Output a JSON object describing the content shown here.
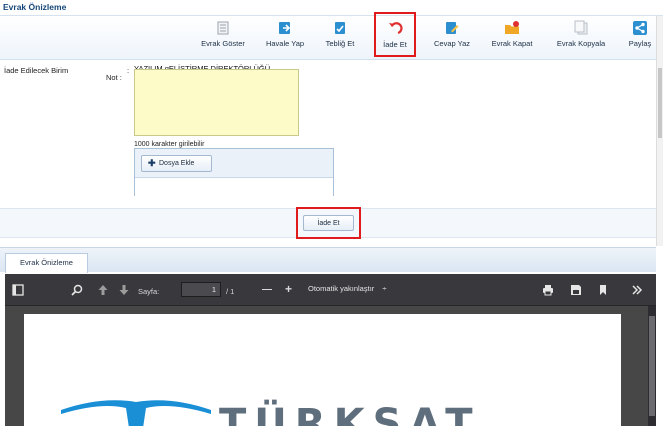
{
  "window": {
    "title": "Evrak Önizleme"
  },
  "toolbar": {
    "items": [
      {
        "label": "Evrak Göster",
        "icon": "document-view-icon",
        "highlighted": false
      },
      {
        "label": "Havale Yap",
        "icon": "forward-icon",
        "highlighted": false
      },
      {
        "label": "Tebliğ Et",
        "icon": "notify-icon",
        "highlighted": false
      },
      {
        "label": "İade Et",
        "icon": "return-icon",
        "highlighted": true
      },
      {
        "label": "Cevap Yaz",
        "icon": "reply-icon",
        "highlighted": false
      },
      {
        "label": "Evrak Kapat",
        "icon": "folder-close-icon",
        "highlighted": false
      },
      {
        "label": "Evrak Kopyala",
        "icon": "copy-icon",
        "highlighted": false
      },
      {
        "label": "Paylaş",
        "icon": "share-icon",
        "highlighted": false
      }
    ]
  },
  "form": {
    "unit_label": "İade Edilecek Birim",
    "unit_colon": ":",
    "unit_value": "YAZILIM gELİŞTİRME DİREKTÖRLÜĞÜ",
    "note_label": "Not :",
    "note_value": "",
    "char_limit": "1000 karakter girilebilir",
    "add_file_label": "Dosya Ekle",
    "return_button_label": "İade Et"
  },
  "tabs": [
    {
      "label": "Evrak Önizleme",
      "active": true
    }
  ],
  "pdf_viewer": {
    "page_label": "Sayfa:",
    "page_current": "1",
    "page_total": "/ 1",
    "zoom_label": "Otomatik yakınlaştır",
    "zoom_caret": "÷",
    "zoom_out": "—",
    "zoom_in": "+",
    "document_logo_text": "TÜRKSAT"
  },
  "colors": {
    "highlight": "#e01b1b",
    "note_bg": "#fdfbc8",
    "title_text": "#15467a",
    "pdf_toolbar": "#38383d",
    "logo_blue": "#1a8fd6",
    "logo_gray": "#5f6e7d"
  }
}
